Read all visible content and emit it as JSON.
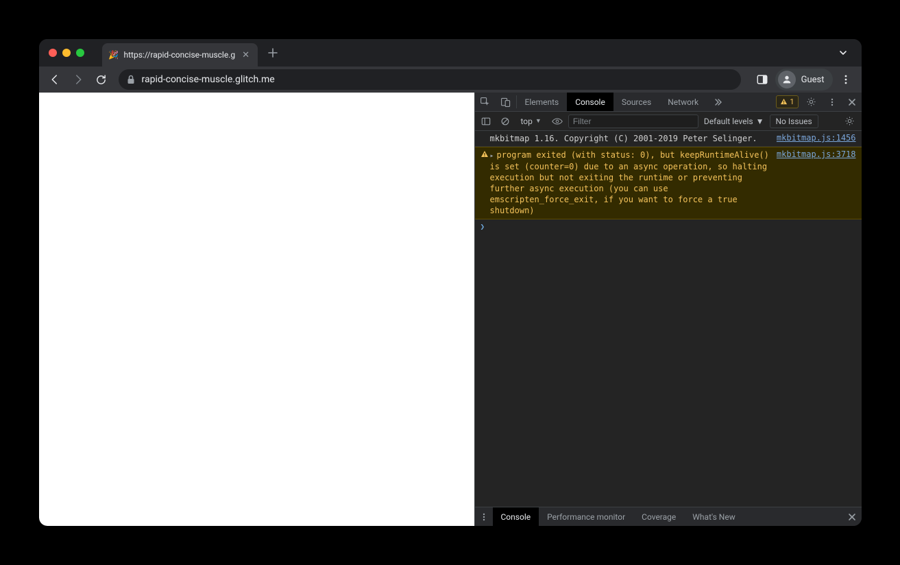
{
  "window": {
    "tab_title": "https://rapid-concise-muscle.g",
    "favicon_emoji": "🎉"
  },
  "toolbar": {
    "url_display": "rapid-concise-muscle.glitch.me",
    "guest_label": "Guest"
  },
  "devtools": {
    "tabs": {
      "elements": "Elements",
      "console": "Console",
      "sources": "Sources",
      "network": "Network"
    },
    "warning_count": "1",
    "console_toolbar": {
      "context": "top",
      "filter_placeholder": "Filter",
      "levels_label": "Default levels",
      "issues_button": "No Issues"
    },
    "logs": [
      {
        "type": "info",
        "message": "mkbitmap 1.16. Copyright (C) 2001-2019 Peter Selinger.",
        "source": "mkbitmap.js:1456"
      },
      {
        "type": "warn",
        "message": "program exited (with status: 0), but keepRuntimeAlive() is set (counter=0) due to an async operation, so halting execution but not exiting the runtime or preventing further async execution (you can use emscripten_force_exit, if you want to force a true shutdown)",
        "source": "mkbitmap.js:3718"
      }
    ],
    "drawer": {
      "console": "Console",
      "perf": "Performance monitor",
      "coverage": "Coverage",
      "whatsnew": "What's New"
    }
  }
}
